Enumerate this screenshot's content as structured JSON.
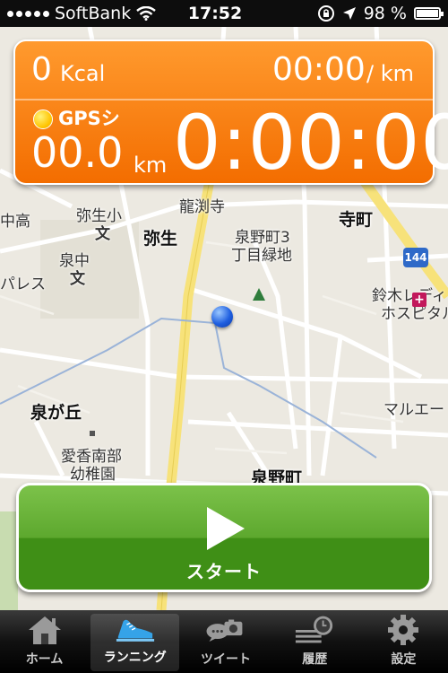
{
  "status_bar": {
    "carrier": "SoftBank",
    "time": "17:52",
    "battery": "98 %",
    "battery_level": 0.98
  },
  "map": {
    "labels": [
      {
        "key": "label_yayoi",
        "text": "弥生"
      },
      {
        "key": "label_yayoisho",
        "text": "弥生小"
      },
      {
        "key": "label_terumachi",
        "text": "寺町"
      },
      {
        "key": "label_ryusenji",
        "text": "龍渕寺"
      },
      {
        "key": "label_izuminomachi3",
        "text": "泉野町3"
      },
      {
        "key": "label_chome_ryokuchi",
        "text": "丁目緑地"
      },
      {
        "key": "label_izuminaka",
        "text": "泉中"
      },
      {
        "key": "label_nakako",
        "text": "中高"
      },
      {
        "key": "label_palace",
        "text": "パレス"
      },
      {
        "key": "label_suzuki",
        "text": "鈴木レディ"
      },
      {
        "key": "label_hospital",
        "text": "ホスピタル"
      },
      {
        "key": "label_izumigaoka",
        "text": "泉が丘"
      },
      {
        "key": "label_marue",
        "text": "マルエー"
      },
      {
        "key": "label_aikou",
        "text": "愛香南部"
      },
      {
        "key": "label_youchien",
        "text": "幼稚園"
      },
      {
        "key": "label_izuminomachi",
        "text": "泉野町"
      },
      {
        "key": "label_bun1",
        "text": "文"
      },
      {
        "key": "label_bun2",
        "text": "文"
      }
    ],
    "route_number": "144"
  },
  "stats": {
    "calories_value": "0",
    "calories_unit": "Kcal",
    "pace_value": "00:00",
    "pace_unit": "/ km",
    "gps_label": "GPSシ",
    "distance_value": "00.0",
    "distance_unit": "km",
    "elapsed_time": "0:00:00"
  },
  "start_button": {
    "label": "スタート"
  },
  "tabs": [
    {
      "label": "ホーム",
      "icon": "home-icon",
      "active": false
    },
    {
      "label": "ランニング",
      "icon": "running-shoe-icon",
      "active": true
    },
    {
      "label": "ツイート",
      "icon": "tweet-camera-icon",
      "active": false
    },
    {
      "label": "履歴",
      "icon": "history-icon",
      "active": false
    },
    {
      "label": "設定",
      "icon": "gear-icon",
      "active": false
    }
  ]
}
